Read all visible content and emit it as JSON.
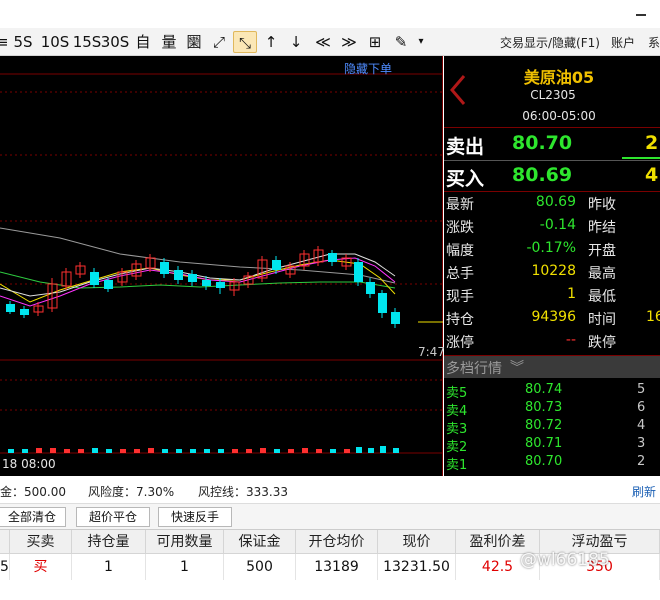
{
  "toolbar": {
    "buttons": [
      "≡",
      "5S",
      "10S",
      "15S",
      "30S",
      "自",
      "量",
      "圞",
      "⤢",
      "⤡",
      "↑",
      "↓",
      "≪",
      "≫",
      "⊞",
      "✎",
      "▾"
    ],
    "trade_toggle": "交易显示/隐藏(F1)",
    "account": "账户",
    "system": "系"
  },
  "chart": {
    "hide_order_label": "隐藏下单",
    "time_label": "7:47",
    "date_label": "18 08:00"
  },
  "quote": {
    "name": "美原油05",
    "code": "CL2305",
    "session": "06:00-05:00",
    "sell_label": "卖出",
    "sell_price": "80.70",
    "sell_vol": "2",
    "buy_label": "买入",
    "buy_price": "80.69",
    "buy_vol": "4",
    "rows": [
      {
        "label": "最新",
        "value": "80.69",
        "label2": "昨收",
        "value2": ""
      },
      {
        "label": "涨跌",
        "value": "-0.14",
        "label2": "昨结",
        "value2": ""
      },
      {
        "label": "幅度",
        "value": "-0.17%",
        "label2": "开盘",
        "value2": ""
      },
      {
        "label": "总手",
        "value": "10228",
        "label2": "最高",
        "value2": ""
      },
      {
        "label": "现手",
        "value": "1",
        "label2": "最低",
        "value2": ""
      },
      {
        "label": "持仓",
        "value": "94396",
        "label2": "时间",
        "value2": "16"
      },
      {
        "label": "涨停",
        "value": "--",
        "label2": "跌停",
        "value2": ""
      }
    ],
    "depth_title": "多档行情",
    "depth": [
      {
        "label": "卖5",
        "price": "80.74",
        "vol": "5"
      },
      {
        "label": "卖4",
        "price": "80.73",
        "vol": "6"
      },
      {
        "label": "卖3",
        "price": "80.72",
        "vol": "4"
      },
      {
        "label": "卖2",
        "price": "80.71",
        "vol": "3"
      },
      {
        "label": "卖1",
        "price": "80.70",
        "vol": "2"
      }
    ]
  },
  "status": {
    "margin": "金：500.00",
    "risk": "风险度：7.30%",
    "control": "风控线：333.33",
    "refresh": "刷新"
  },
  "actions": {
    "close_all": "全部清仓",
    "super_close": "超价平仓",
    "reverse": "快速反手"
  },
  "table": {
    "headers": [
      "",
      "买卖",
      "持仓量",
      "可用数量",
      "保证金",
      "开仓均价",
      "现价",
      "盈利价差",
      "浮动盈亏"
    ],
    "row": [
      "5",
      "买",
      "1",
      "1",
      "500",
      "13189",
      "13231.50",
      "42.5",
      "350"
    ]
  },
  "watermark": "@wl66185",
  "colors": {
    "up": "#ff3030",
    "down": "#00e5ee",
    "green_text": "#2ee62e",
    "yellow_text": "#f0e000",
    "title_gold": "#f0c000",
    "grid_red": "#7a0000"
  }
}
